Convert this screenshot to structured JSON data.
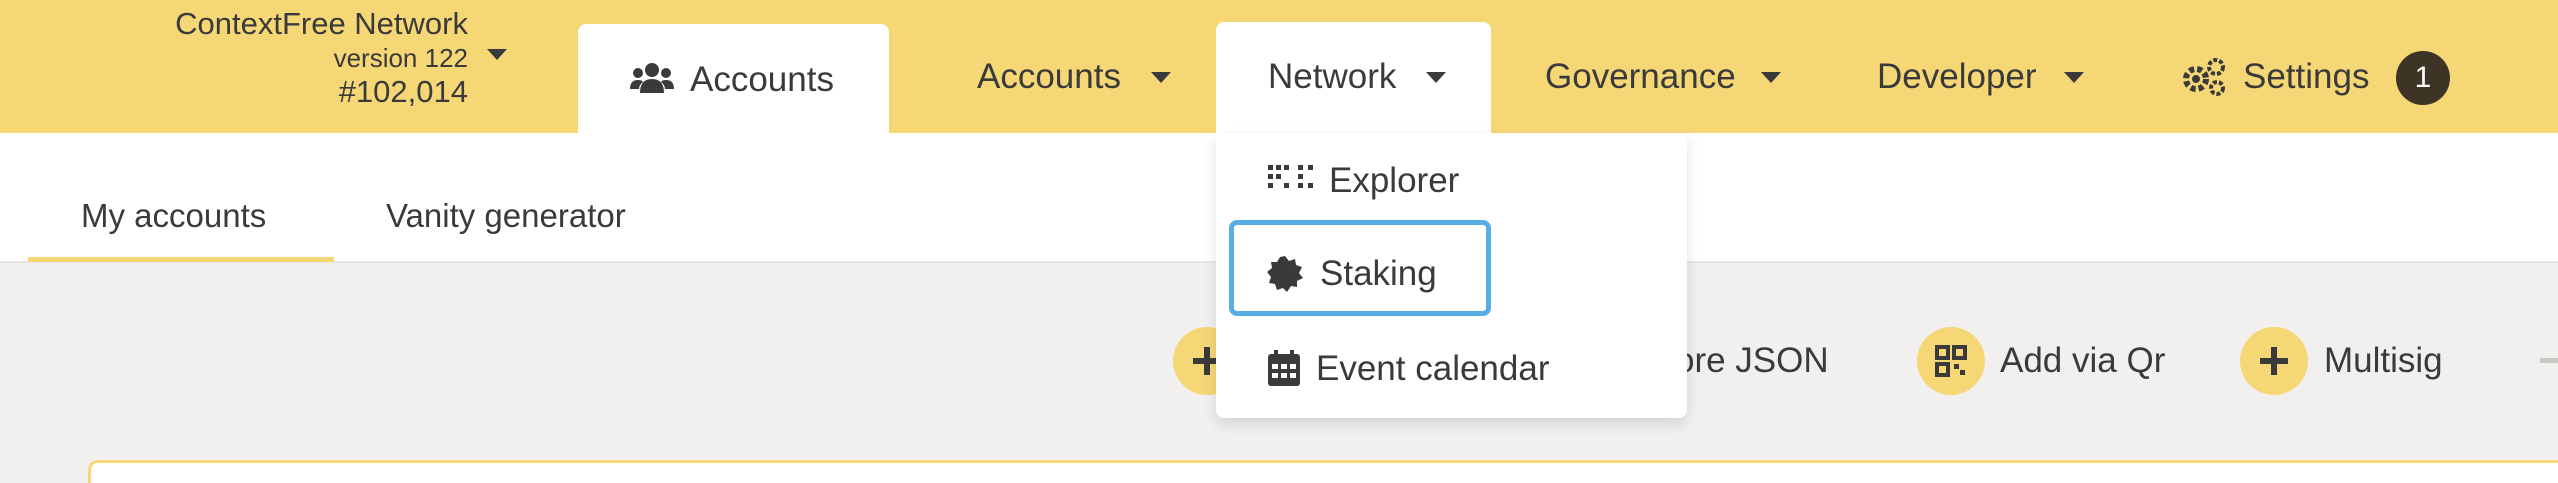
{
  "chain": {
    "name": "ContextFree Network",
    "version": "version 122",
    "block": "#102,014"
  },
  "nav": {
    "active_tab": "Accounts",
    "items": [
      {
        "label": "Accounts"
      },
      {
        "label": "Network"
      },
      {
        "label": "Governance"
      },
      {
        "label": "Developer"
      },
      {
        "label": "Settings"
      }
    ],
    "settings_badge": "1"
  },
  "subtabs": [
    {
      "label": "My accounts",
      "selected": true
    },
    {
      "label": "Vanity generator",
      "selected": false
    }
  ],
  "network_menu": {
    "items": [
      {
        "label": "Explorer",
        "icon": "explorer-dots-icon"
      },
      {
        "label": "Staking",
        "icon": "staking-badge-icon",
        "focused": true
      },
      {
        "label": "Event calendar",
        "icon": "calendar-icon"
      }
    ]
  },
  "actions": {
    "restore_json_partial": "ore JSON",
    "add_via_qr": "Add via Qr",
    "multisig": "Multisig"
  },
  "colors": {
    "accent": "#f6d776",
    "focus": "#56aee7",
    "badge": "#3d3425",
    "text": "#3a3a3a"
  }
}
